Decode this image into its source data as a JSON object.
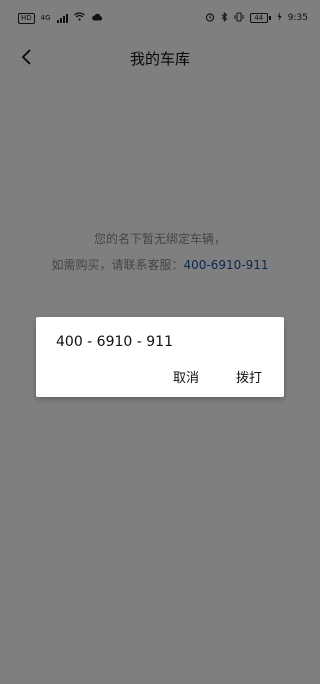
{
  "status_bar": {
    "hd_label": "HD",
    "network_label": "4G",
    "battery_label": "44",
    "time": "9:35"
  },
  "header": {
    "title": "我的车库"
  },
  "empty_state": {
    "line1": "您的名下暂无绑定车辆，",
    "line2_prefix": "如需购买，请联系客服：",
    "phone": "400-6910-911"
  },
  "dialog": {
    "number": "400 - 6910 - 911",
    "cancel_label": "取消",
    "call_label": "拨打"
  },
  "colors": {
    "overlay": "#000000",
    "link": "#1e50a2",
    "empty_text": "#8a8a8a"
  }
}
